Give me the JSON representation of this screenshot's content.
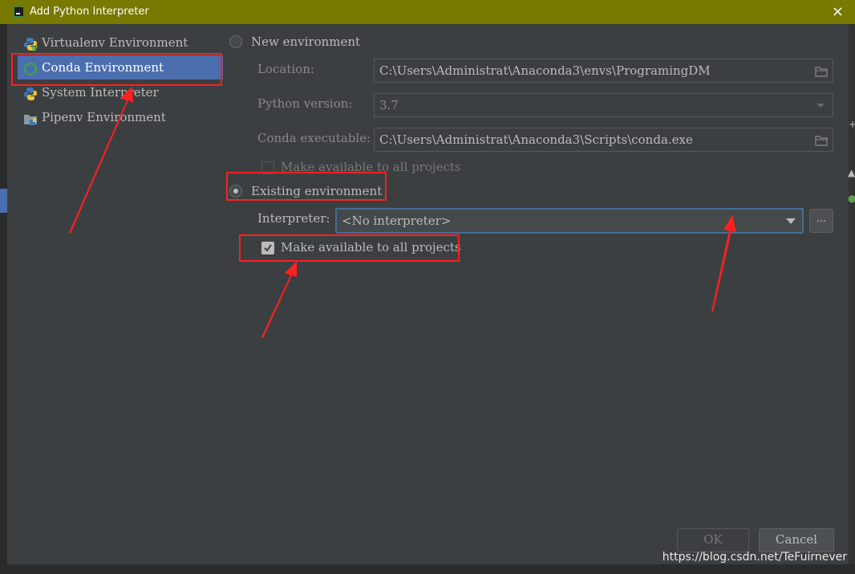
{
  "window": {
    "title": "Add Python Interpreter",
    "close_glyph": "×"
  },
  "sidebar": {
    "items": [
      {
        "label": "Virtualenv Environment",
        "icon": "virtualenv-icon"
      },
      {
        "label": "Conda Environment",
        "icon": "conda-icon",
        "selected": true
      },
      {
        "label": "System Interpreter",
        "icon": "python-icon"
      },
      {
        "label": "Pipenv Environment",
        "icon": "pipenv-icon"
      }
    ]
  },
  "new_env": {
    "radio_label": "New environment",
    "location_label": "Location:",
    "location_value": "C:\\Users\\Administrat\\Anaconda3\\envs\\ProgramingDM",
    "python_version_label": "Python version:",
    "python_version_value": "3.7",
    "conda_exec_label": "Conda executable:",
    "conda_exec_value": "C:\\Users\\Administrat\\Anaconda3\\Scripts\\conda.exe",
    "make_available_label": "Make available to all projects"
  },
  "existing_env": {
    "radio_label": "Existing environment",
    "selected": true,
    "interpreter_label": "Interpreter:",
    "interpreter_value": "<No interpreter>",
    "more_button": "...",
    "make_available_label": "Make available to all projects",
    "make_available_checked": true
  },
  "buttons": {
    "ok": "OK",
    "cancel": "Cancel"
  },
  "watermark": "https://blog.csdn.net/TeFuirnever",
  "colors": {
    "titlebar": "#777900",
    "selection": "#4b6eaf",
    "annotation": "#ff2020",
    "focus_border": "#466d94"
  }
}
